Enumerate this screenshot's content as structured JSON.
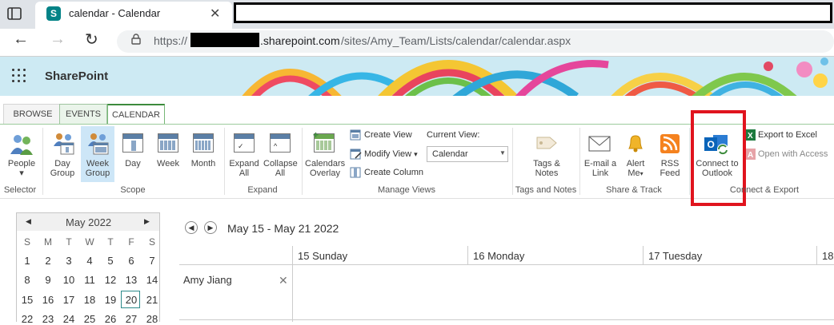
{
  "browser": {
    "tab_title": "calendar - Calendar",
    "tab_favicon": "S",
    "tab_close": "✕",
    "url_prefix": "https://",
    "url_domain": ".sharepoint.com",
    "url_path": "/sites/Amy_Team/Lists/calendar/calendar.aspx"
  },
  "suite": {
    "app_name": "SharePoint"
  },
  "ribbon": {
    "tabs": [
      "BROWSE",
      "EVENTS",
      "CALENDAR"
    ],
    "selector": {
      "people_label": "People",
      "group_label": "Selector"
    },
    "scope": {
      "buttons": [
        "Day Group",
        "Week Group",
        "Day",
        "Week",
        "Month"
      ],
      "group_label": "Scope"
    },
    "expand": {
      "buttons": [
        "Expand All",
        "Collapse All"
      ],
      "group_label": "Expand"
    },
    "manage_views": {
      "calendars_overlay": "Calendars Overlay",
      "create_view": "Create View",
      "modify_view": "Modify View",
      "create_column": "Create Column",
      "current_view_label": "Current View:",
      "current_view_value": "Calendar",
      "group_label": "Manage Views"
    },
    "tags_notes": {
      "button": "Tags & Notes",
      "group_label": "Tags and Notes"
    },
    "share_track": {
      "buttons": [
        "E-mail a Link",
        "Alert Me",
        "RSS Feed"
      ],
      "group_label": "Share & Track"
    },
    "connect_export": {
      "connect_outlook": "Connect to Outlook",
      "export_excel": "Export to Excel",
      "open_access": "Open with Access",
      "group_label": "Connect & Export"
    }
  },
  "mini_calendar": {
    "month": "May 2022",
    "weekdays": [
      "S",
      "M",
      "T",
      "W",
      "T",
      "F",
      "S"
    ],
    "weeks": [
      [
        "1",
        "2",
        "3",
        "4",
        "5",
        "6",
        "7"
      ],
      [
        "8",
        "9",
        "10",
        "11",
        "12",
        "13",
        "14"
      ],
      [
        "15",
        "16",
        "17",
        "18",
        "19",
        "20",
        "21"
      ],
      [
        "22",
        "23",
        "24",
        "25",
        "26",
        "27",
        "28"
      ]
    ],
    "today": "20"
  },
  "week_view": {
    "range": "May 15 - May 21 2022",
    "days": [
      "15 Sunday",
      "16 Monday",
      "17 Tuesday",
      "18"
    ],
    "person": "Amy Jiang",
    "person_remove": "✕"
  },
  "colors": {
    "accent_green": "#3c8b3c",
    "highlight_red": "#e0141e",
    "sharepoint_teal": "#038387"
  }
}
